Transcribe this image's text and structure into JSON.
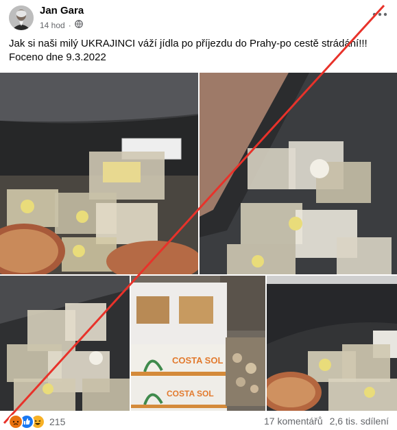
{
  "post": {
    "author": "Jan Gara",
    "time": "14 hod",
    "privacy_icon": "globe-icon",
    "more_icon": "more-options-icon",
    "text_line1": "Jak si naši milý UKRAJINCI váží jídla po příjezdu do Prahy-po cestě strádání!!!",
    "text_line2": "Foceno dne 9.3.2022"
  },
  "photos": [
    {
      "id": "photo-1",
      "alt": "food-containers-in-bin"
    },
    {
      "id": "photo-2",
      "alt": "food-containers-closeup"
    },
    {
      "id": "photo-3",
      "alt": "food-containers-in-bin-2"
    },
    {
      "id": "photo-4",
      "alt": "banana-boxes-costa-sol"
    },
    {
      "id": "photo-5",
      "alt": "food-containers-in-bin-3"
    }
  ],
  "box_labels": {
    "brand1": "COSTA SOL",
    "brand2": "COSTA SOL"
  },
  "footer": {
    "reaction_icons": [
      "angry-icon",
      "like-icon",
      "haha-icon"
    ],
    "reaction_count": "215",
    "comments": "17 komentářů",
    "shares": "2,6 tis. sdílení"
  },
  "colors": {
    "strike_line": "#e8322a",
    "text": "#050505",
    "muted": "#65676b"
  }
}
